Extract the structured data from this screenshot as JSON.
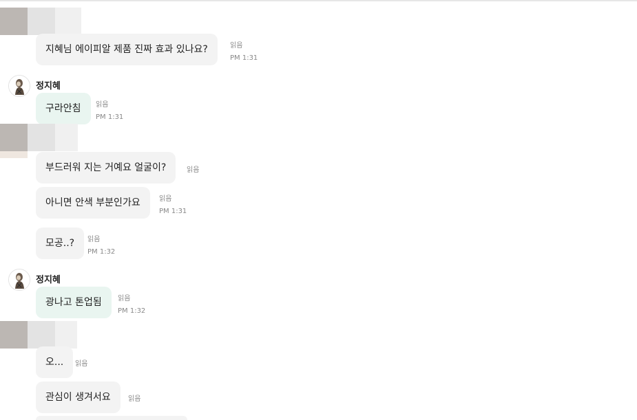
{
  "read_label": "읽음",
  "messages": [
    {
      "text": "지혜님 에이피알 제품 진짜 효과 있나요?",
      "time": "PM 1:31"
    },
    {
      "sender": "정지혜",
      "text": "구라안침",
      "time": "PM 1:31"
    },
    {
      "text": "부드러워 지는 거예요 얼굴이?",
      "time": ""
    },
    {
      "text": "아니면 안색 부분인가요",
      "time": "PM 1:31"
    },
    {
      "text": "모공..?",
      "time": "PM 1:32"
    },
    {
      "sender": "정지혜",
      "text": "광나고 톤업됨",
      "time": "PM 1:32"
    },
    {
      "text": "오...",
      "time": ""
    },
    {
      "text": "관심이 생겨서요",
      "time": ""
    }
  ],
  "colors": {
    "incoming_bubble": "#f3f3f3",
    "own_bubble": "#e9f5f0",
    "meta_text": "#888888"
  }
}
